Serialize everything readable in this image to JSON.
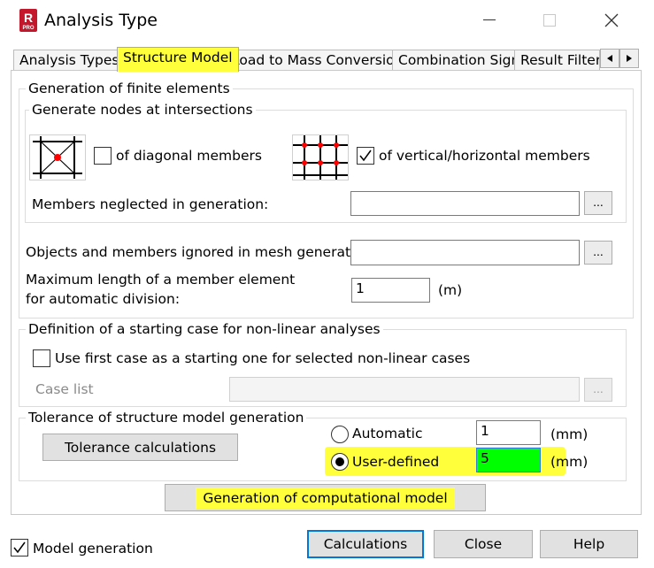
{
  "window": {
    "title": "Analysis Type",
    "app_badge": "R",
    "app_badge_sub": "PRO"
  },
  "tabs": [
    {
      "label": "Analysis Types",
      "active": false
    },
    {
      "label": "Structure Model",
      "active": true
    },
    {
      "label": "Load to Mass Conversion",
      "active": false
    },
    {
      "label": "Combination Sign",
      "active": false
    },
    {
      "label": "Result Filters",
      "active": false
    }
  ],
  "generation": {
    "group_label": "Generation of finite elements",
    "intersections": {
      "group_label": "Generate nodes at intersections",
      "diagonal_label": "of diagonal members",
      "diagonal_checked": false,
      "vh_label": "of vertical/horizontal members",
      "vh_checked": true,
      "neglected_label": "Members neglected in generation:",
      "neglected_value": ""
    },
    "ignored_label": "Objects and members ignored in mesh generation:",
    "ignored_value": "",
    "max_length_label_1": "Maximum length of a member element",
    "max_length_label_2": "for automatic division:",
    "max_length_value": "1",
    "max_length_unit": "(m)"
  },
  "nonlinear": {
    "group_label": "Definition of a starting case for non-linear analyses",
    "use_first_label": "Use first case as a starting one for selected non-linear cases",
    "use_first_checked": false,
    "case_list_label": "Case list",
    "case_list_value": ""
  },
  "tolerance": {
    "group_label": "Tolerance of structure model generation",
    "calc_button": "Tolerance calculations",
    "automatic_label": "Automatic",
    "automatic_value": "1",
    "automatic_unit": "(mm)",
    "user_defined_label": "User-defined",
    "user_defined_value": "5",
    "user_defined_unit": "(mm)",
    "selected": "user-defined"
  },
  "generate_button": "Generation of computational model",
  "footer": {
    "model_generation_label": "Model generation",
    "model_generation_checked": true,
    "calculations": "Calculations",
    "close": "Close",
    "help": "Help"
  },
  "colors": {
    "highlight": "#ffff3c",
    "input_highlight": "#00ff00",
    "default_button_border": "#0078d7"
  }
}
